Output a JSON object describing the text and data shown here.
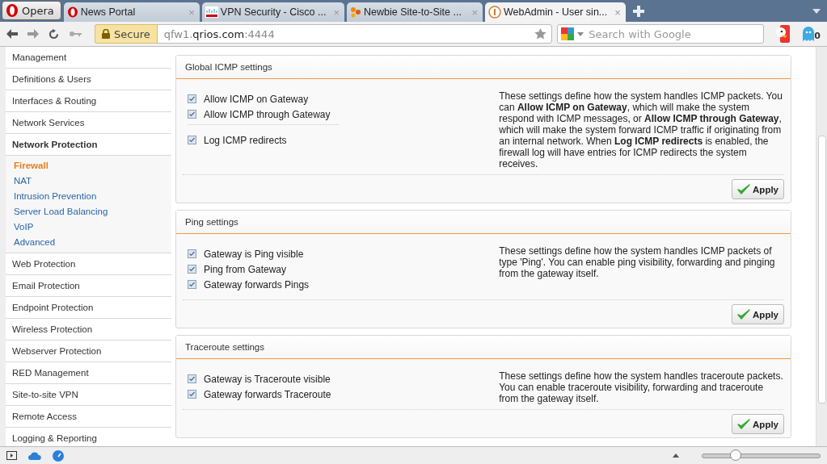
{
  "browser": {
    "menu_button": "Opera",
    "tabs": [
      {
        "title": "News Portal",
        "close": "×",
        "selected": false
      },
      {
        "title": "VPN Security - Cisco ...",
        "close": "×",
        "selected": false
      },
      {
        "title": "Newbie Site-to-Site ...",
        "close": "×",
        "selected": false
      },
      {
        "title": "WebAdmin - User sin...",
        "close": "×",
        "selected": true
      }
    ],
    "secure_badge": "Secure",
    "address": "qfw1.**qrios.com**:4444",
    "search": {
      "placeholder": "Search with Google"
    },
    "extension_badge": "0"
  },
  "sidebar": {
    "items": [
      {
        "label": "Management",
        "expanded": false
      },
      {
        "label": "Definitions & Users",
        "expanded": false
      },
      {
        "label": "Interfaces & Routing",
        "expanded": false
      },
      {
        "label": "Network Services",
        "expanded": false
      },
      {
        "label": "Network Protection",
        "expanded": true,
        "children": [
          {
            "label": "Firewall",
            "selected": true
          },
          {
            "label": "NAT",
            "selected": false
          },
          {
            "label": "Intrusion Prevention",
            "selected": false
          },
          {
            "label": "Server Load Balancing",
            "selected": false
          },
          {
            "label": "VoIP",
            "selected": false
          },
          {
            "label": "Advanced",
            "selected": false
          }
        ]
      },
      {
        "label": "Web Protection",
        "expanded": false
      },
      {
        "label": "Email Protection",
        "expanded": false
      },
      {
        "label": "Endpoint Protection",
        "expanded": false
      },
      {
        "label": "Wireless Protection",
        "expanded": false
      },
      {
        "label": "Webserver Protection",
        "expanded": false
      },
      {
        "label": "RED Management",
        "expanded": false
      },
      {
        "label": "Site-to-site VPN",
        "expanded": false
      },
      {
        "label": "Remote Access",
        "expanded": false
      },
      {
        "label": "Logging & Reporting",
        "expanded": false
      }
    ]
  },
  "panels": [
    {
      "title": "Global ICMP settings",
      "option_groups": [
        [
          {
            "label": "Allow ICMP on Gateway",
            "checked": true
          },
          {
            "label": "Allow ICMP through Gateway",
            "checked": true
          }
        ],
        [
          {
            "label": "Log ICMP redirects",
            "checked": true
          }
        ]
      ],
      "description": "These settings define how the system handles ICMP packets. You can **Allow ICMP on Gateway**, which will make the system respond with ICMP messages, or **Allow ICMP through Gateway**, which will make the system forward ICMP traffic if originating from an internal network. When **Log ICMP redirects** is enabled, the firewall log will have entries for ICMP redirects the system receives.",
      "button": "Apply"
    },
    {
      "title": "Ping settings",
      "option_groups": [
        [
          {
            "label": "Gateway is Ping visible",
            "checked": true
          },
          {
            "label": "Ping from Gateway",
            "checked": true
          },
          {
            "label": "Gateway forwards Pings",
            "checked": true
          }
        ]
      ],
      "description": "These settings define how the system handles ICMP packets of type 'Ping'. You can enable ping visibility, forwarding and pinging from the gateway itself.",
      "button": "Apply"
    },
    {
      "title": "Traceroute settings",
      "option_groups": [
        [
          {
            "label": "Gateway is Traceroute visible",
            "checked": true
          },
          {
            "label": "Gateway forwards Traceroute",
            "checked": true
          }
        ]
      ],
      "description": "These settings define how the system handles traceroute packets. You can enable traceroute visibility, forwarding and traceroute from the gateway itself.",
      "button": "Apply"
    }
  ],
  "status_bar": {
    "zoom": {
      "level": 0.28
    }
  }
}
